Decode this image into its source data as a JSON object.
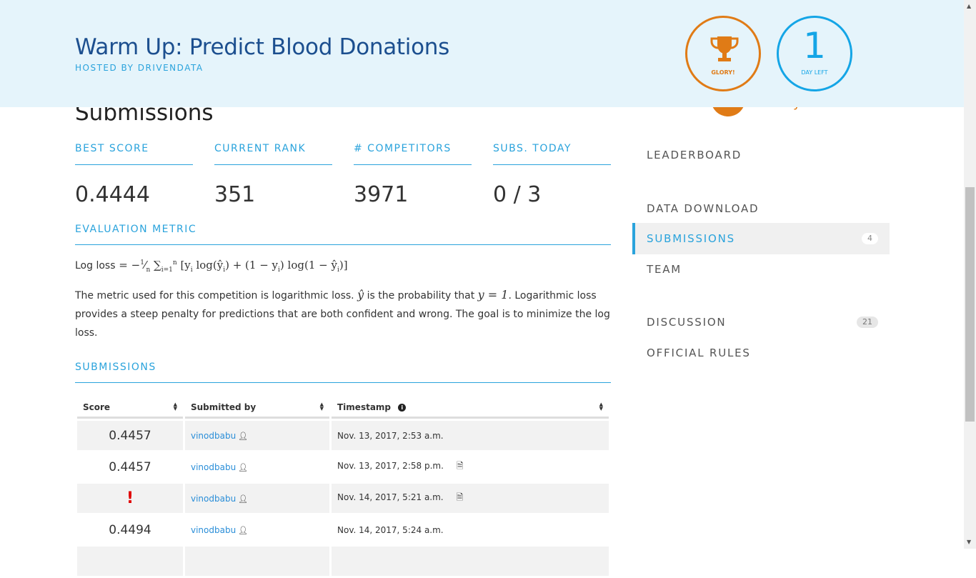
{
  "header": {
    "title": "Warm Up: Predict Blood Donations",
    "hosted_by": "HOSTED BY DRIVENDATA",
    "glory_label": "GLORY!",
    "days_number": "1",
    "days_label": "DAY LEFT",
    "accent_orange": "#e07b16",
    "accent_blue": "#14a5e6"
  },
  "page": {
    "heading": "Submissions",
    "peek_text": "y"
  },
  "stats": [
    {
      "label": "BEST SCORE",
      "value": "0.4444"
    },
    {
      "label": "CURRENT RANK",
      "value": "351"
    },
    {
      "label": "# COMPETITORS",
      "value": "3971"
    },
    {
      "label": "SUBS. TODAY",
      "value": "0 / 3"
    }
  ],
  "evaluation": {
    "title": "EVALUATION METRIC",
    "formula_label": "Log loss",
    "description_1": "The metric used for this competition is logarithmic loss.",
    "yhat": "ŷ",
    "description_2": "is the probability that",
    "y_eq": "y = 1",
    "description_3": ". Logarithmic loss provides a steep penalty for predictions that are both confident and wrong. The goal is to minimize the log loss."
  },
  "submissions": {
    "title": "SUBMISSIONS",
    "columns": [
      "Score",
      "Submitted by",
      "Timestamp"
    ],
    "rows": [
      {
        "score": "0.4457",
        "user": "vinodbabu",
        "timestamp": "Nov. 13, 2017, 2:53 a.m.",
        "has_file": false,
        "error": false
      },
      {
        "score": "0.4457",
        "user": "vinodbabu",
        "timestamp": "Nov. 13, 2017, 2:58 p.m.",
        "has_file": true,
        "error": false
      },
      {
        "score": "!",
        "user": "vinodbabu",
        "timestamp": "Nov. 14, 2017, 5:21 a.m.",
        "has_file": true,
        "error": true
      },
      {
        "score": "0.4494",
        "user": "vinodbabu",
        "timestamp": "Nov. 14, 2017, 5:24 a.m.",
        "has_file": false,
        "error": false
      }
    ]
  },
  "nav": {
    "leaderboard": "LEADERBOARD",
    "data_download": "DATA DOWNLOAD",
    "submissions": "SUBMISSIONS",
    "submissions_count": "4",
    "team": "TEAM",
    "discussion": "DISCUSSION",
    "discussion_count": "21",
    "official_rules": "OFFICIAL RULES"
  }
}
